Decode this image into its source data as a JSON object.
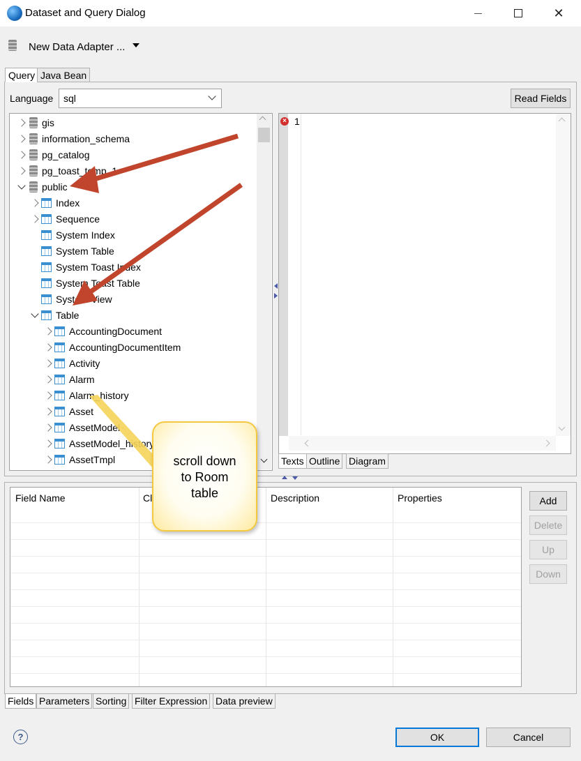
{
  "window": {
    "title": "Dataset and Query Dialog",
    "close_glyph": "✕"
  },
  "adapter": {
    "label": "New Data Adapter ..."
  },
  "main_tabs": [
    {
      "label": "Query"
    },
    {
      "label": "Java Bean"
    }
  ],
  "query": {
    "language_label": "Language",
    "language_value": "sql",
    "read_fields_label": "Read Fields"
  },
  "tree": {
    "items": [
      {
        "label": "gis"
      },
      {
        "label": "information_schema"
      },
      {
        "label": "pg_catalog"
      },
      {
        "label": "pg_toast_temp_1"
      },
      {
        "label": "public"
      },
      {
        "label": "Index"
      },
      {
        "label": "Sequence"
      },
      {
        "label": "System Index"
      },
      {
        "label": "System Table"
      },
      {
        "label": "System Toast Index"
      },
      {
        "label": "System Toast Table"
      },
      {
        "label": "System View"
      },
      {
        "label": "Table"
      },
      {
        "label": "AccountingDocument"
      },
      {
        "label": "AccountingDocumentItem"
      },
      {
        "label": "Activity"
      },
      {
        "label": "Alarm"
      },
      {
        "label": "Alarm_history"
      },
      {
        "label": "Asset"
      },
      {
        "label": "AssetModel"
      },
      {
        "label": "AssetModel_history"
      },
      {
        "label": "AssetTmpl"
      }
    ]
  },
  "editor": {
    "line_number": "1",
    "error_glyph": "×"
  },
  "editor_tabs": [
    {
      "label": "Texts"
    },
    {
      "label": "Outline"
    },
    {
      "label": "Diagram"
    }
  ],
  "fields_table": {
    "columns": [
      "Field Name",
      "Cl",
      "Description",
      "Properties"
    ]
  },
  "field_buttons": {
    "add": "Add",
    "delete": "Delete",
    "up": "Up",
    "down": "Down"
  },
  "bottom_tabs": [
    {
      "label": "Fields"
    },
    {
      "label": "Parameters"
    },
    {
      "label": "Sorting"
    },
    {
      "label": "Filter Expression"
    },
    {
      "label": "Data preview"
    }
  ],
  "footer": {
    "help_glyph": "?",
    "ok": "OK",
    "cancel": "Cancel"
  },
  "callout": {
    "line1": "scroll down",
    "line2": "to Room",
    "line3": "table"
  },
  "colors": {
    "annotation_arrow": "#c0452c",
    "callout_border": "#f5c842",
    "ok_focus": "#0078d7"
  }
}
